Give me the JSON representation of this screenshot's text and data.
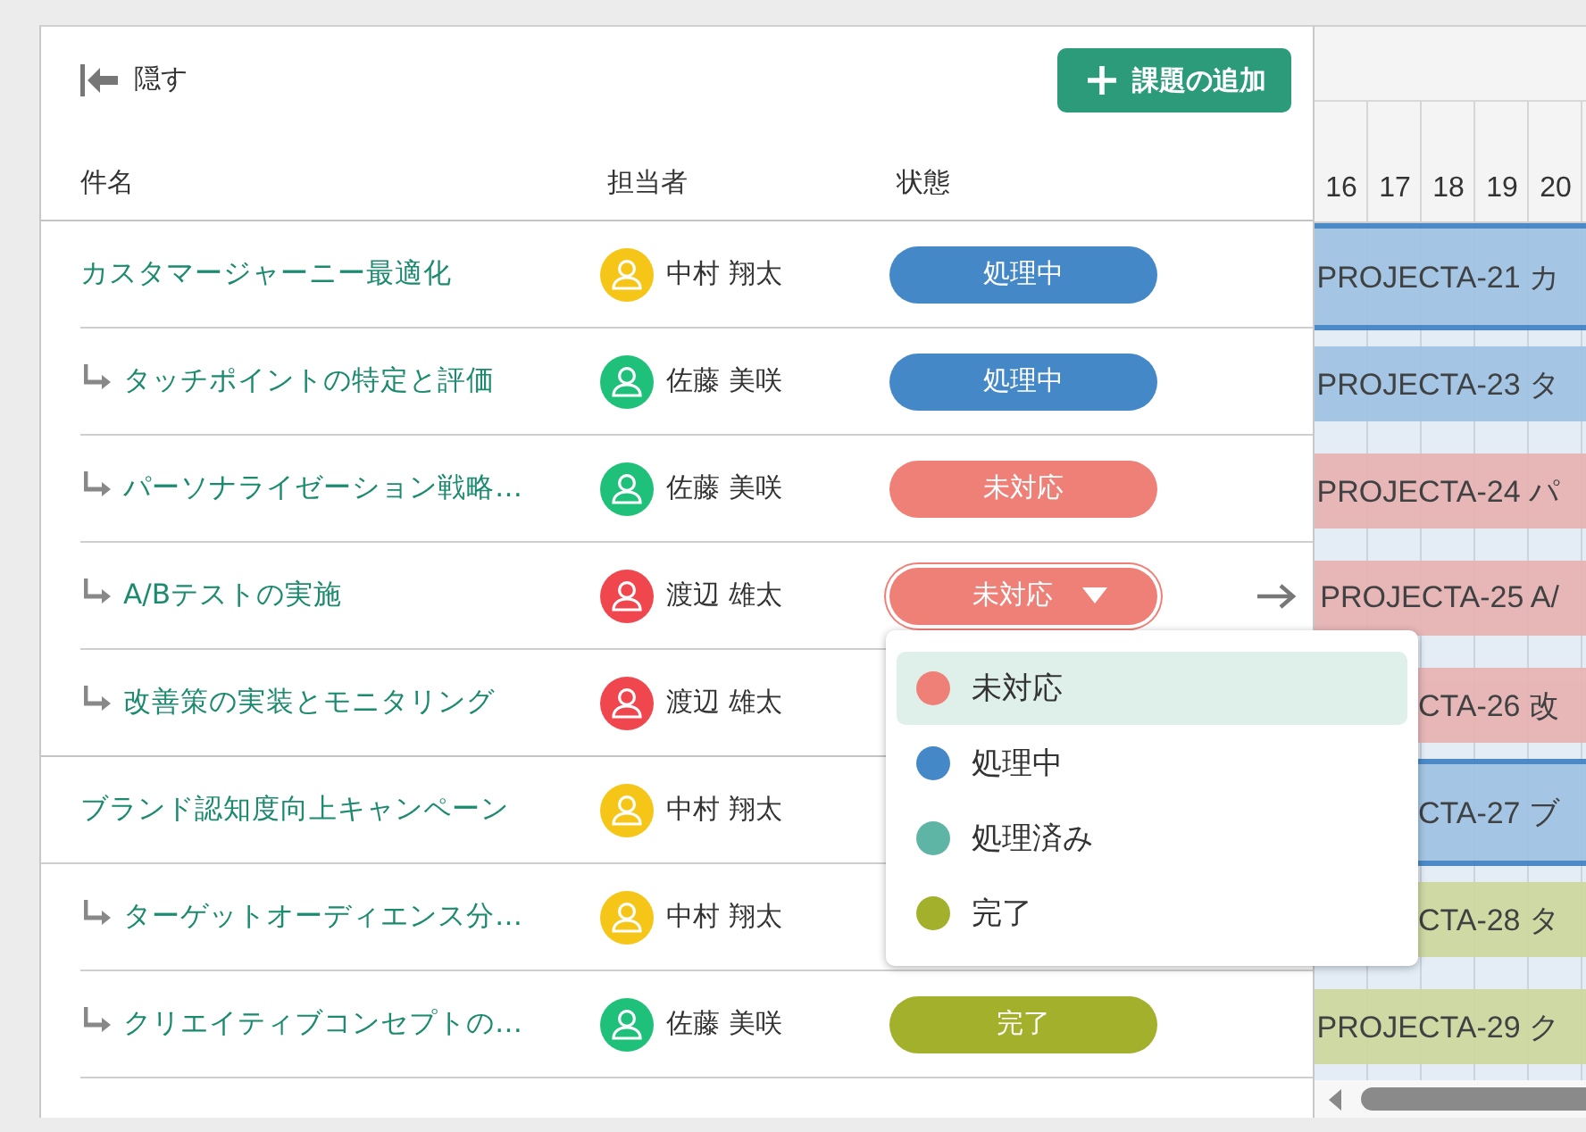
{
  "toolbar": {
    "hide_label": "隠す",
    "add_button": "課題の追加"
  },
  "columns": [
    "件名",
    "担当者",
    "状態"
  ],
  "tasks": [
    {
      "title": "カスタマージャーニー最適化",
      "assignee": {
        "name": "中村 翔太",
        "color": "#f5c518"
      },
      "status": {
        "label": "処理中",
        "kind": "in_progress"
      },
      "bar": "PROJECTA-21 カ",
      "children": [
        {
          "title": "タッチポイントの特定と評価",
          "assignee": {
            "name": "佐藤 美咲",
            "color": "#1fc07a"
          },
          "status": {
            "label": "処理中",
            "kind": "in_progress"
          },
          "bar": "PROJECTA-23 タ"
        },
        {
          "title": "パーソナライゼーション戦略…",
          "assignee": {
            "name": "佐藤 美咲",
            "color": "#1fc07a"
          },
          "status": {
            "label": "未対応",
            "kind": "open"
          },
          "bar": "PROJECTA-24 パ"
        },
        {
          "title": "A/Bテストの実施",
          "assignee": {
            "name": "渡辺 雄太",
            "color": "#f0474f"
          },
          "status": {
            "label": "未対応",
            "kind": "open",
            "dropdown_open": true
          },
          "bar": "PROJECTA-25 A/"
        },
        {
          "title": "改善策の実装とモニタリング",
          "assignee": {
            "name": "渡辺 雄太",
            "color": "#f0474f"
          },
          "status": {
            "kind": "open"
          },
          "bar": "CTA-26 改"
        }
      ]
    },
    {
      "title": "ブランド認知度向上キャンペーン",
      "assignee": {
        "name": "中村 翔太",
        "color": "#f5c518"
      },
      "status": {
        "kind": "in_progress"
      },
      "bar": "CTA-27 ブ",
      "children": [
        {
          "title": "ターゲットオーディエンス分…",
          "assignee": {
            "name": "中村 翔太",
            "color": "#f5c518"
          },
          "status": {
            "kind": "done"
          },
          "bar": "CTA-28 タ"
        },
        {
          "title": "クリエイティブコンセプトの…",
          "assignee": {
            "name": "佐藤 美咲",
            "color": "#1fc07a"
          },
          "status": {
            "label": "完了",
            "kind": "done"
          },
          "bar": "PROJECTA-29 ク"
        }
      ]
    }
  ],
  "gantt": {
    "days": [
      "16",
      "17",
      "18",
      "19",
      "20"
    ]
  },
  "status_menu": [
    {
      "label": "未対応",
      "color": "#ef8078",
      "selected": true
    },
    {
      "label": "処理中",
      "color": "#4488c8",
      "selected": false
    },
    {
      "label": "処理済み",
      "color": "#5fb5a5",
      "selected": false
    },
    {
      "label": "完了",
      "color": "#a3b02b",
      "selected": false
    }
  ]
}
